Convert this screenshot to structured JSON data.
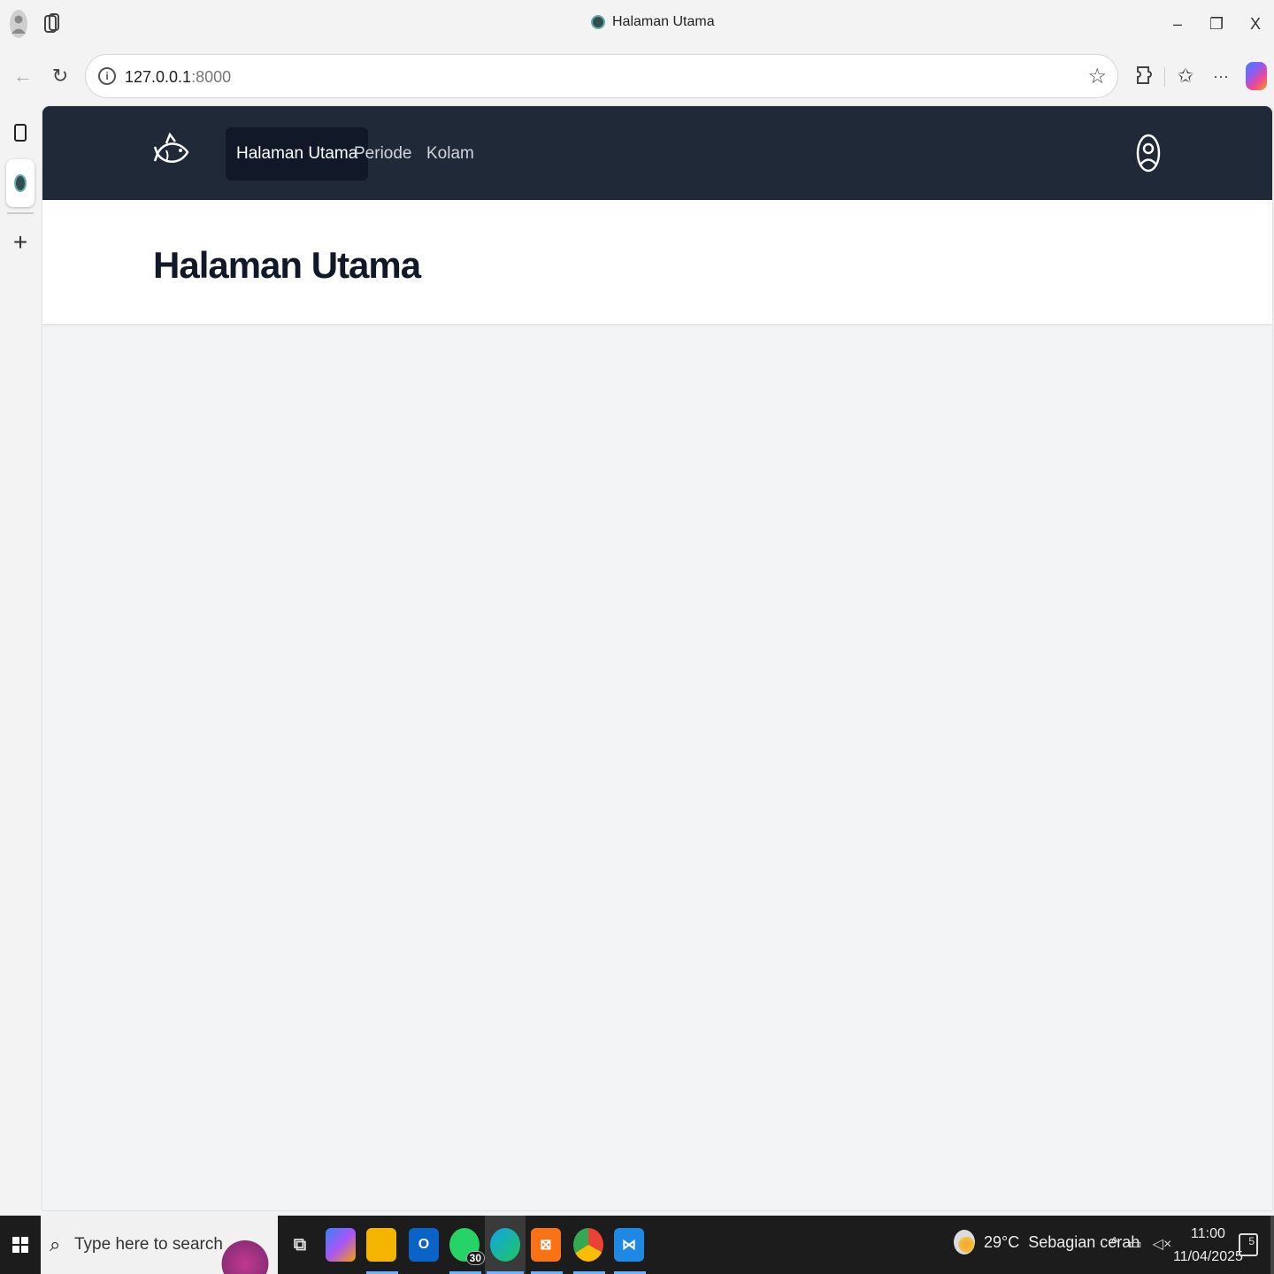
{
  "browser": {
    "tab_title": "Halaman Utama",
    "url_host": "127.0.0.1",
    "url_port": ":8000",
    "window_controls": {
      "minimize": "–",
      "maximize": "❐",
      "close": "X"
    }
  },
  "app": {
    "nav": {
      "items": [
        {
          "label": "Halaman Utama",
          "active": true
        },
        {
          "label": "Periode",
          "active": false
        },
        {
          "label": "Kolam",
          "active": false
        }
      ]
    },
    "header": {
      "title": "Halaman Utama"
    }
  },
  "taskbar": {
    "search_placeholder": "Type here to search",
    "whatsapp_badge": "30",
    "weather": {
      "temp": "29°C",
      "desc": "Sebagian cerah"
    },
    "clock": {
      "time": "11:00",
      "date": "11/04/2025"
    },
    "notifications_count": "5"
  },
  "colors": {
    "nav_bg": "#1f2937",
    "nav_active_bg": "#111827",
    "page_bg": "#f3f4f6",
    "title_color": "#111827"
  }
}
